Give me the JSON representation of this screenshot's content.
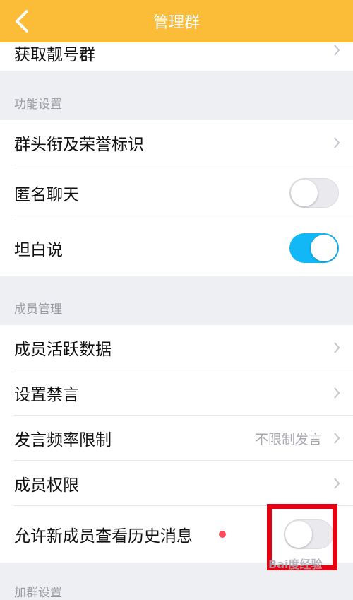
{
  "header": {
    "title": "管理群",
    "back_icon": "chevron-left-icon"
  },
  "top_row": {
    "label": "获取靓号群"
  },
  "sections": {
    "function": {
      "title": "功能设置"
    },
    "member": {
      "title": "成员管理"
    },
    "join": {
      "title": "加群设置"
    }
  },
  "function_rows": [
    {
      "label": "群头衔及荣誉标识",
      "type": "link"
    },
    {
      "label": "匿名聊天",
      "type": "toggle",
      "on": false
    },
    {
      "label": "坦白说",
      "type": "toggle",
      "on": true
    }
  ],
  "member_rows": [
    {
      "label": "成员活跃数据",
      "type": "link"
    },
    {
      "label": "设置禁言",
      "type": "link"
    },
    {
      "label": "发言频率限制",
      "type": "link",
      "value": "不限制发言"
    },
    {
      "label": "成员权限",
      "type": "link"
    },
    {
      "label": "允许新成员查看历史消息",
      "type": "toggle",
      "on": false,
      "badge": "red-dot"
    }
  ],
  "colors": {
    "accent": "#fbbc37",
    "toggle_on": "#12b7f5",
    "highlight": "#e60012"
  },
  "watermark": {
    "text": "Bai度经验"
  }
}
